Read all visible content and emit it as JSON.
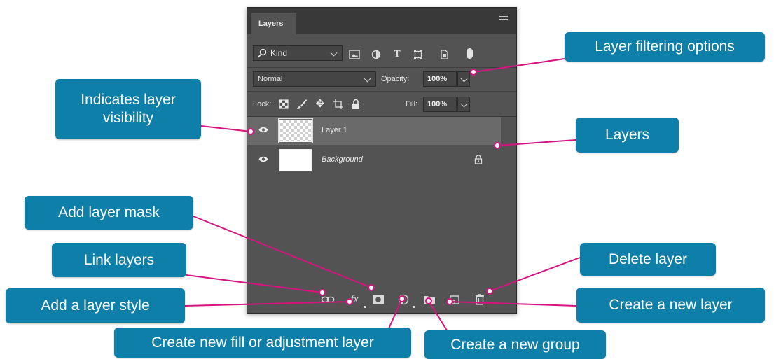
{
  "panel": {
    "tab_label": "Layers",
    "filter": {
      "kind_label": "Kind"
    },
    "blend_mode": "Normal",
    "opacity_label": "Opacity:",
    "opacity_value": "100%",
    "lock_label": "Lock:",
    "fill_label": "Fill:",
    "fill_value": "100%",
    "layers": [
      {
        "name": "Layer 1",
        "selected": true,
        "visible": true,
        "thumbnail": "transparent"
      },
      {
        "name": "Background",
        "selected": false,
        "visible": true,
        "thumbnail": "white",
        "locked": true
      }
    ],
    "bottom_icons": [
      "link-icon",
      "fx-icon",
      "mask-icon",
      "adjustment-icon",
      "folder-icon",
      "new-layer-icon",
      "trash-icon"
    ]
  },
  "callouts": {
    "filtering": "Layer filtering options",
    "visibility_line1": "Indicates layer",
    "visibility_line2": "visibility",
    "layers": "Layers",
    "mask": "Add layer mask",
    "link": "Link layers",
    "style": "Add a layer style",
    "delete": "Delete layer",
    "new_layer": "Create a new layer",
    "fill_adjust": "Create new fill or adjustment layer",
    "new_group": "Create a new group"
  },
  "colors": {
    "callout": "#0e7fa8",
    "leader_line": "#d6137f",
    "panel_bg": "#535353",
    "selected_row": "#6a6a6a"
  }
}
